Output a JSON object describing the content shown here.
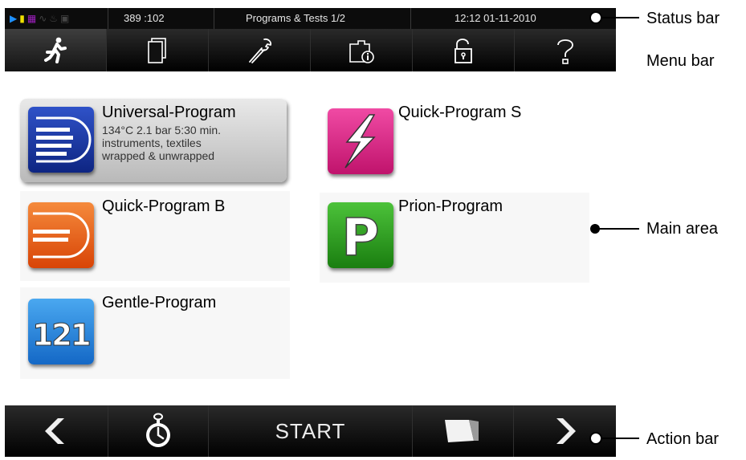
{
  "status_bar": {
    "counter": "389 :102",
    "title": "Programs & Tests 1/2",
    "clock": "12:12  01-11-2010",
    "icons": [
      "play-icon",
      "memory-card-icon",
      "network-icon",
      "chart-icon",
      "water-icon",
      "lock-icon"
    ]
  },
  "menu_bar": {
    "items": [
      {
        "icon": "running-man-icon",
        "active": true
      },
      {
        "icon": "pages-icon",
        "active": false
      },
      {
        "icon": "wrench-icon",
        "active": false
      },
      {
        "icon": "info-folder-icon",
        "active": false
      },
      {
        "icon": "padlock-icon",
        "active": false
      },
      {
        "icon": "help-icon",
        "active": false
      }
    ]
  },
  "programs": [
    {
      "name": "Universal-Program",
      "icon": "universal-program-icon",
      "color": "#1f3ea8",
      "selected": true,
      "description": [
        "134°C 2.1 bar 5:30 min.",
        "instruments, textiles",
        "wrapped & unwrapped"
      ]
    },
    {
      "name": "Quick-Program S",
      "icon": "lightning-icon",
      "color": "#e0308a",
      "selected": false,
      "description": []
    },
    {
      "name": "Quick-Program B",
      "icon": "quick-program-b-icon",
      "color": "#e8631c",
      "selected": false,
      "description": []
    },
    {
      "name": "Prion-Program",
      "icon": "prion-p-icon",
      "color": "#2e9e1e",
      "selected": false,
      "description": []
    },
    {
      "name": "Gentle-Program",
      "icon": "gentle-121-icon",
      "color": "#2f8ee2",
      "selected": false,
      "description": []
    }
  ],
  "icon_text": {
    "prion": "P",
    "gentle": "121"
  },
  "action_bar": {
    "start_label": "START",
    "icons": [
      "back-arrow-icon",
      "stopwatch-icon",
      "door-icon",
      "forward-arrow-icon"
    ]
  },
  "callouts": {
    "status": "Status bar",
    "menu": "Menu bar",
    "main": "Main area",
    "action": "Action bar"
  }
}
